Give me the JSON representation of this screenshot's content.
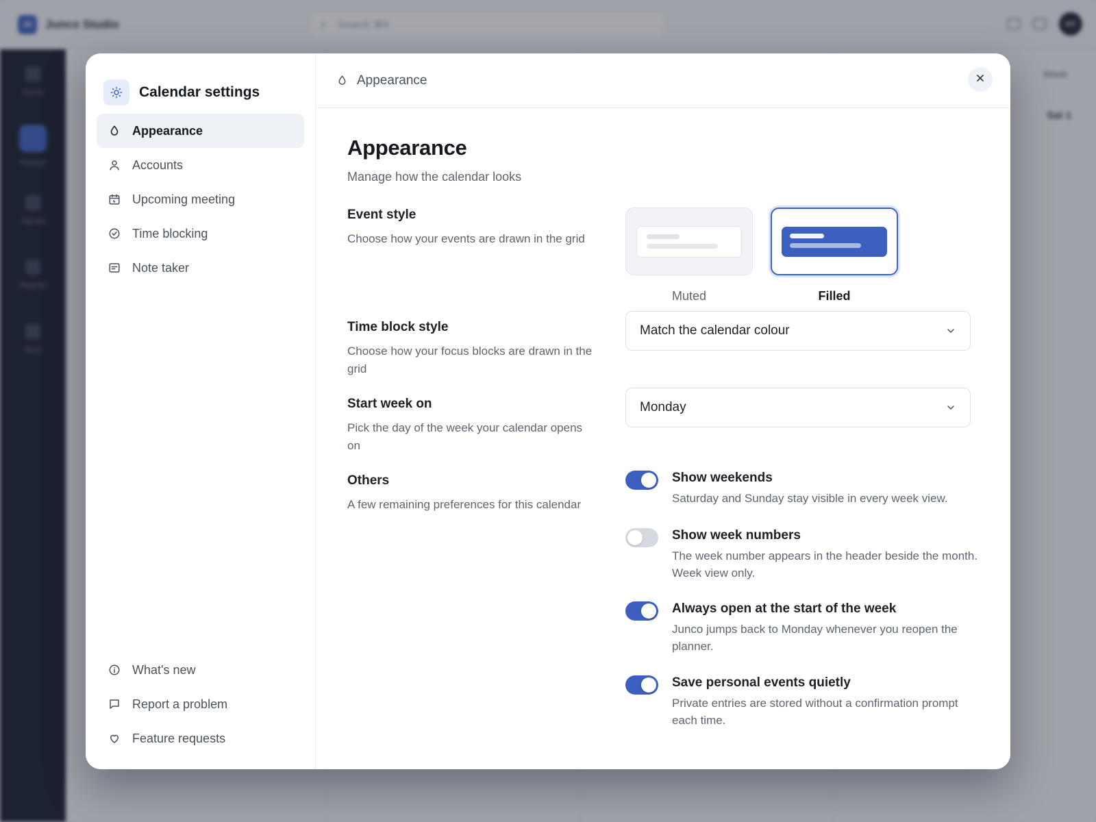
{
  "background": {
    "brand_logo": "JS",
    "brand_name": "Junco Studio",
    "search_placeholder": "Search ⌘K",
    "avatar_initials": "MH",
    "rail": [
      "Home",
      "Planner",
      "Signals",
      "Reports",
      "More"
    ],
    "view_select": "Week",
    "day_label": "Sat 1"
  },
  "sidebar": {
    "title": "Calendar settings",
    "title_icon": "gear-icon",
    "items": [
      {
        "label": "Appearance",
        "icon": "droplet-icon",
        "active": true
      },
      {
        "label": "Accounts",
        "icon": "user-icon"
      },
      {
        "label": "Upcoming meeting",
        "icon": "calendar-icon"
      },
      {
        "label": "Time blocking",
        "icon": "check-circle-icon"
      },
      {
        "label": "Note taker",
        "icon": "note-icon"
      }
    ],
    "footer": [
      {
        "label": "What's new",
        "icon": "info-icon"
      },
      {
        "label": "Report a problem",
        "icon": "message-icon"
      },
      {
        "label": "Feature requests",
        "icon": "heart-icon"
      }
    ]
  },
  "header": {
    "breadcrumb": "Appearance",
    "close_icon": "close-icon"
  },
  "page": {
    "title": "Appearance",
    "subtitle": "Manage how the calendar looks"
  },
  "event_style": {
    "label": "Event style",
    "description": "Choose how your events are drawn in the grid",
    "options": [
      {
        "name": "Muted",
        "selected": false
      },
      {
        "name": "Filled",
        "selected": true
      }
    ]
  },
  "time_block_style": {
    "label": "Time block style",
    "description": "Choose how your focus blocks are drawn in the grid",
    "value": "Match the calendar colour"
  },
  "start_week": {
    "label": "Start week on",
    "description": "Pick the day of the week your calendar opens on",
    "value": "Monday"
  },
  "others": {
    "label": "Others",
    "description": "A few remaining preferences for this calendar",
    "toggles": [
      {
        "title": "Show weekends",
        "description": "Saturday and Sunday stay visible in every week view.",
        "on": true
      },
      {
        "title": "Show week numbers",
        "description": "The week number appears in the header beside the month. Week view only.",
        "on": false
      },
      {
        "title": "Always open at the start of the week",
        "description": "Junco jumps back to Monday whenever you reopen the planner.",
        "on": true
      },
      {
        "title": "Save personal events quietly",
        "description": "Private entries are stored without a confirmation prompt each time.",
        "on": true
      }
    ]
  },
  "colors": {
    "accent": "#3d5fbf",
    "rail": "#161b2a"
  }
}
